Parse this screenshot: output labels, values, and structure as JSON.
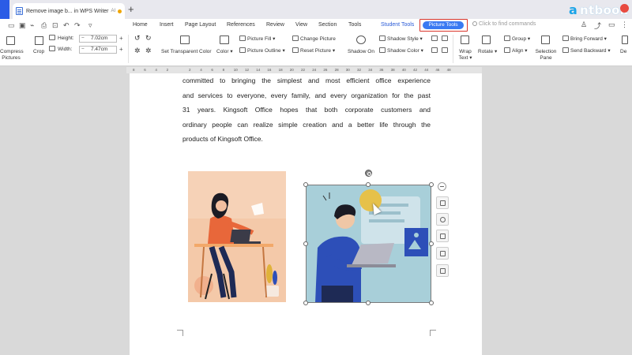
{
  "tab": {
    "title": "Remove image b... in WPS Writer",
    "ai_badge": "AI"
  },
  "brand": {
    "first_letter": "a",
    "rest": "ntbook"
  },
  "quick_access": {
    "icons": [
      "folder-icon",
      "save-icon",
      "format-painter-icon",
      "print-icon",
      "print-preview-icon",
      "undo-icon",
      "redo-icon",
      "customize-icon"
    ]
  },
  "menu": {
    "items": [
      "Home",
      "Insert",
      "Page Layout",
      "References",
      "Review",
      "View",
      "Section",
      "Tools"
    ],
    "student_tools": "Student Tools",
    "picture_tools": "Picture Tools",
    "search_placeholder": "Click to find commands"
  },
  "ribbon": {
    "compress": "Compress Pictures",
    "crop": "Crop",
    "height_label": "Height:",
    "height_value": "7.02cm",
    "width_label": "Width:",
    "width_value": "7.47cm",
    "set_transparent": "Set Transparent Color",
    "color": "Color",
    "picture_fill": "Picture Fill",
    "picture_outline": "Picture Outline",
    "change_picture": "Change Picture",
    "reset_picture": "Reset Picture",
    "shadow_on": "Shadow On",
    "shadow_style": "Shadow Style",
    "shadow_color": "Shadow Color",
    "wrap_text": "Wrap Text",
    "rotate": "Rotate",
    "group": "Group",
    "align": "Align",
    "selection_pane": "Selection Pane",
    "bring_forward": "Bring Forward",
    "send_backward": "Send Backward",
    "de": "De"
  },
  "ruler": {
    "ticks": [
      "8",
      "6",
      "4",
      "2",
      "",
      "2",
      "4",
      "6",
      "8",
      "10",
      "12",
      "14",
      "16",
      "18",
      "20",
      "22",
      "24",
      "26",
      "28",
      "30",
      "32",
      "34",
      "36",
      "38",
      "40",
      "42",
      "44",
      "46",
      "48"
    ]
  },
  "document": {
    "lines": [
      "committed to bringing the simplest and most efficient office experience",
      "and services to everyone, every family, and every organization for the past",
      "31 years. Kingsoft Office hopes that both corporate customers and",
      "ordinary people can realize simple creation and a better life through the",
      "products of Kingsoft Office."
    ]
  },
  "colors": {
    "accent": "#3a7af2",
    "highlight_box": "#d9352b",
    "left_image_bg": "#f4c9a9",
    "right_image_bg": "#a8cfd9",
    "shirt_orange": "#e8673a",
    "shirt_blue": "#2d4fb8",
    "brand_cyan": "#1aa4e8"
  }
}
